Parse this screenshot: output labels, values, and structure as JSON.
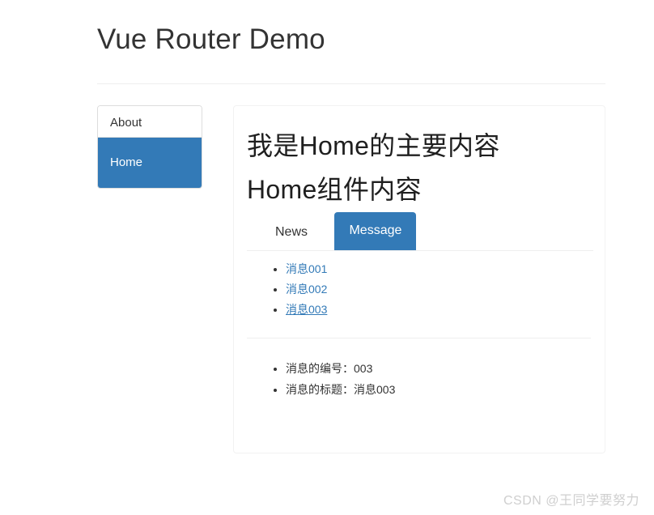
{
  "header": {
    "title": "Vue Router Demo"
  },
  "sidebar": {
    "items": [
      {
        "label": "About",
        "active": false
      },
      {
        "label": "Home",
        "active": true
      }
    ]
  },
  "main": {
    "headings": [
      "我是Home的主要内容",
      "Home组件内容"
    ],
    "tabs": [
      {
        "label": "News",
        "active": false
      },
      {
        "label": "Message",
        "active": true
      }
    ],
    "messages": [
      {
        "label": "消息001",
        "current": false
      },
      {
        "label": "消息002",
        "current": false
      },
      {
        "label": "消息003",
        "current": true
      }
    ],
    "detail": [
      "消息的编号：003",
      "消息的标题：消息003"
    ]
  },
  "watermark": {
    "text": "CSDN @王同学要努力"
  },
  "colors": {
    "primary": "#337ab7",
    "link": "#337ab7",
    "text": "#333333",
    "border": "#dddddd",
    "rule": "#eeeeee",
    "watermark": "#cfcfcf"
  }
}
